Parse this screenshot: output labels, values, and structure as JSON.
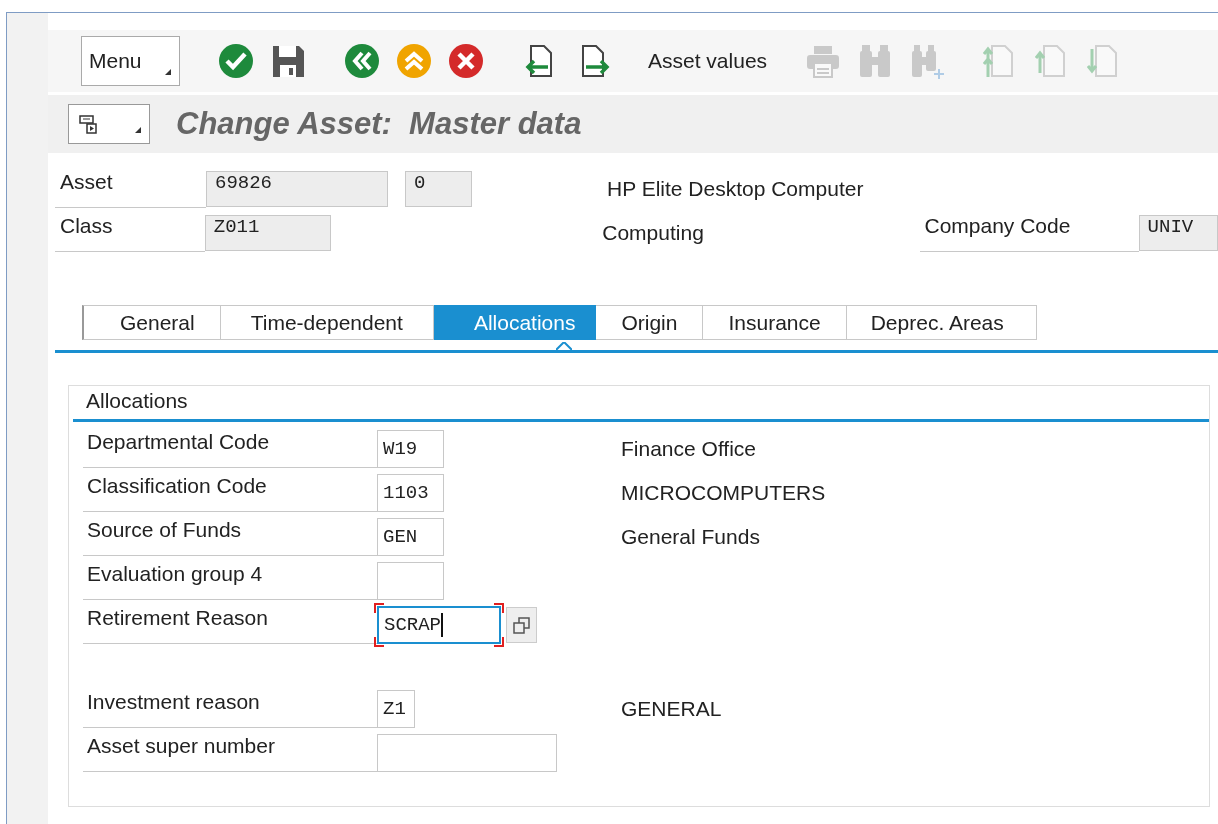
{
  "toolbar": {
    "groups": [
      [
        {
          "kind": "menu",
          "label": "Menu",
          "disabled": false
        }
      ],
      [
        {
          "kind": "icon",
          "disabled": false
        },
        {
          "kind": "icon",
          "disabled": false
        }
      ],
      [
        {
          "kind": "icon",
          "disabled": false
        },
        {
          "kind": "icon",
          "disabled": false
        },
        {
          "kind": "icon",
          "disabled": false
        }
      ],
      [
        {
          "kind": "icon",
          "disabled": false
        },
        {
          "kind": "icon",
          "disabled": false
        }
      ],
      [
        {
          "kind": "text",
          "label": "Asset values",
          "disabled": false
        }
      ],
      [
        {
          "kind": "icon",
          "disabled": true
        },
        {
          "kind": "icon",
          "disabled": true
        },
        {
          "kind": "icon",
          "disabled": true
        }
      ],
      [
        {
          "kind": "icon",
          "disabled": true
        },
        {
          "kind": "icon",
          "disabled": true
        },
        {
          "kind": "icon",
          "disabled": true
        }
      ]
    ]
  },
  "title": "Change Asset:  Master data",
  "header": {
    "rows": [
      {
        "label": "Asset",
        "fields": [
          {
            "value": "69826",
            "read_only": true
          },
          {
            "value": "0",
            "read_only": true
          }
        ],
        "description": "HP Elite Desktop Computer"
      },
      {
        "label": "Class",
        "fields": [
          {
            "value": "Z011",
            "read_only": true
          }
        ],
        "description": "Computing",
        "extra_label": "Company Code",
        "extra_field": {
          "value": "UNIV",
          "read_only": true
        }
      }
    ]
  },
  "tabs": [
    {
      "label": "General",
      "selected": false
    },
    {
      "label": "Time-dependent",
      "selected": false
    },
    {
      "label": "Allocations",
      "selected": true
    },
    {
      "label": "Origin",
      "selected": false
    },
    {
      "label": "Insurance",
      "selected": false
    },
    {
      "label": "Deprec. Areas",
      "selected": false
    }
  ],
  "group_box": {
    "title": "Allocations",
    "field_groups": [
      [
        {
          "label": "Departmental Code",
          "value": "W19",
          "description": "Finance Office",
          "focused": false
        },
        {
          "label": "Classification Code",
          "value": "1103",
          "description": "MICROCOMPUTERS",
          "focused": false
        },
        {
          "label": "Source of Funds",
          "value": "GEN",
          "description": "General Funds",
          "focused": false
        },
        {
          "label": "Evaluation group 4",
          "focused": false
        },
        {
          "label": "Retirement Reason",
          "value": "SCRAP",
          "focused": true
        }
      ],
      [
        {
          "label": "Investment reason",
          "value": "Z1",
          "description": "GENERAL",
          "focused": false
        },
        {
          "label": "Asset super number",
          "focused": false
        }
      ]
    ]
  }
}
